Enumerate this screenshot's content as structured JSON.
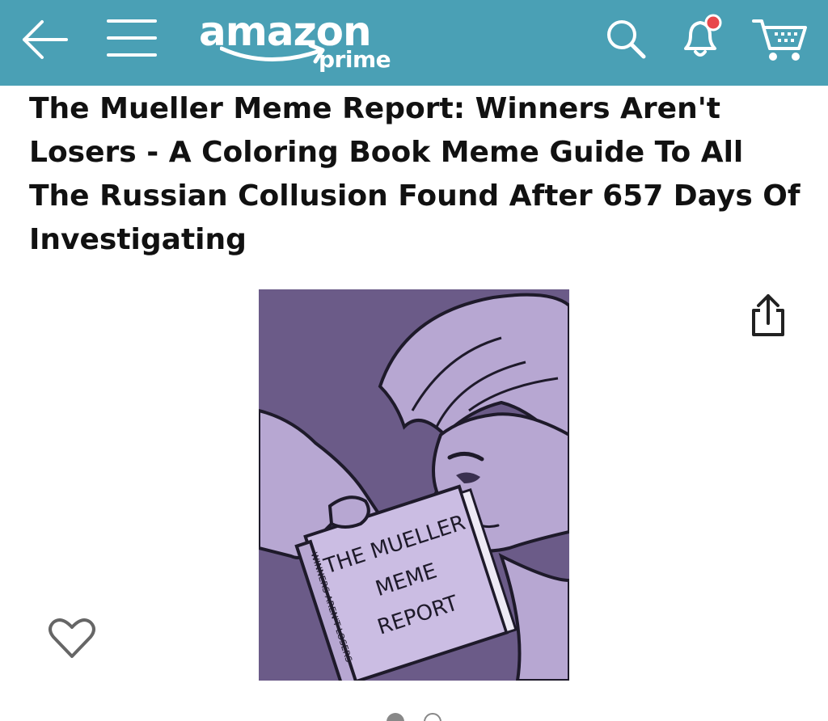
{
  "app": {
    "logo_text": "amazon",
    "logo_sub": "prime",
    "bar_color": "#4aa0b5",
    "notification_dot_color": "#e8474b"
  },
  "header_icons": [
    "back-arrow-icon",
    "menu-icon",
    "search-icon",
    "bell-icon",
    "cart-icon"
  ],
  "product": {
    "title": "The Mueller Meme Report: Winners Aren't Losers - A Coloring Book Meme Guide To All The Russian Collusion Found After 657 Days Of Investigating",
    "cover": {
      "book_title_line1": "THE MUELLER",
      "book_title_line2": "MEME",
      "book_title_line3": "REPORT",
      "spine_text": "WINNERS AREN'T LOSERS"
    }
  },
  "gallery": {
    "image_count": 2,
    "active_index": 0
  }
}
